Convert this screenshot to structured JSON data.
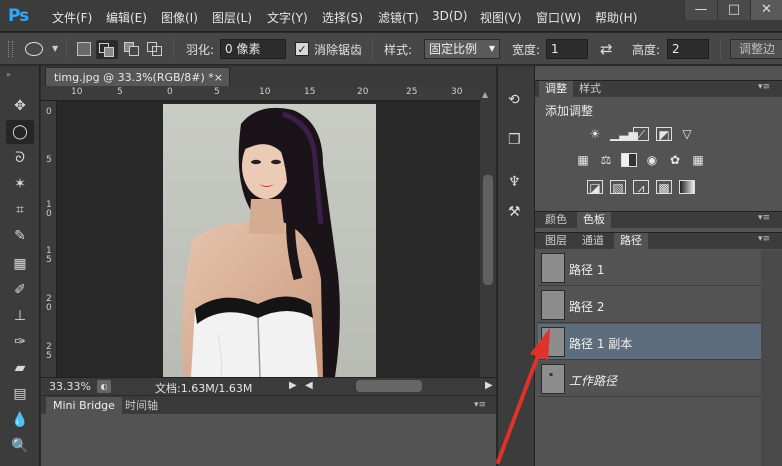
{
  "app": {
    "logo": "Ps"
  },
  "menu": [
    "文件(F)",
    "编辑(E)",
    "图像(I)",
    "图层(L)",
    "文字(Y)",
    "选择(S)",
    "滤镜(T)",
    "3D(D)",
    "视图(V)",
    "窗口(W)",
    "帮助(H)"
  ],
  "window_controls": {
    "minimize": "—",
    "maximize": "□",
    "close": "✕"
  },
  "options": {
    "feather_label": "羽化:",
    "feather_value": "0 像素",
    "antialias_label": "消除锯齿",
    "style_label": "样式:",
    "style_value": "固定比例",
    "width_label": "宽度:",
    "width_value": "1",
    "height_label": "高度:",
    "height_value": "2",
    "refine_edge": "调整边"
  },
  "document": {
    "tab_title": "timg.jpg @ 33.3%(RGB/8#) *",
    "tab_close": "×",
    "ruler_top": [
      "10",
      "5",
      "0",
      "5",
      "10",
      "15",
      "20",
      "25",
      "30"
    ],
    "ruler_left": [
      "0",
      "5",
      "1\n0",
      "1\n5",
      "2\n0",
      "2\n5"
    ],
    "zoom": "33.33%",
    "doc_info": "文档:1.63M/1.63M"
  },
  "bottom_panel": {
    "tabs": [
      "Mini Bridge",
      "时间轴"
    ]
  },
  "adjustments": {
    "tabs": [
      "调整",
      "样式"
    ],
    "title": "添加调整"
  },
  "color_panel": {
    "tabs": [
      "颜色",
      "色板"
    ]
  },
  "paths_panel": {
    "tabs": [
      "图层",
      "通道",
      "路径"
    ],
    "items": [
      "路径 1",
      "路径 2",
      "路径 1 副本",
      "工作路径"
    ]
  },
  "colors": {
    "accent": "#31a8ff",
    "selected_row": "#5d6d7e",
    "arrow": "#e0312a"
  }
}
